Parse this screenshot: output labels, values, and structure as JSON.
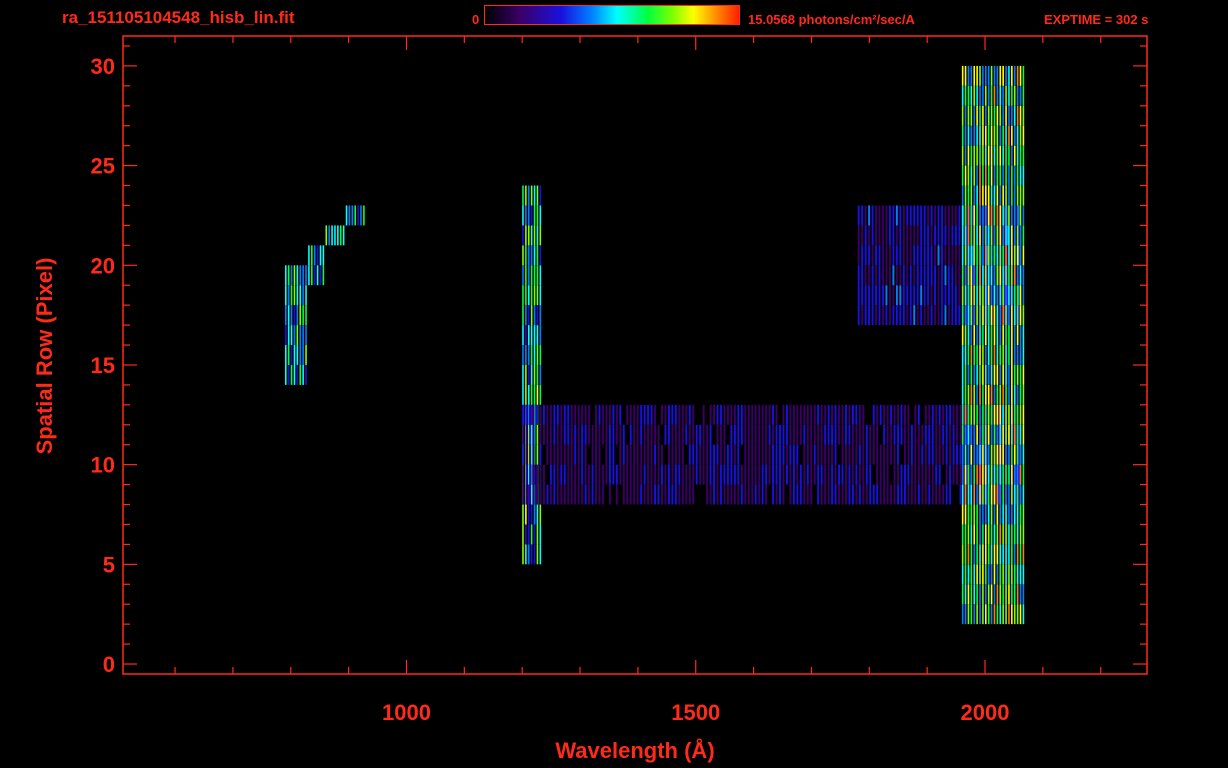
{
  "header": {
    "file_title": "ra_151105104548_hisb_lin.fit",
    "colorbar_min": "0",
    "colorbar_max_label": "15.0568 photons/cm²/sec/A",
    "exptime": "EXPTIME = 302 s"
  },
  "colors": {
    "axis": "#ff2a1a",
    "background": "#000000",
    "colormap": [
      "#000000",
      "#3a0068",
      "#1a10e0",
      "#0080ff",
      "#00ffff",
      "#00ff40",
      "#80ff00",
      "#ffff00",
      "#ff8000",
      "#ff2000"
    ]
  },
  "chart_data": {
    "type": "heatmap",
    "xlabel": "Wavelength (Å)",
    "ylabel": "Spatial Row (Pixel)",
    "xlim": [
      510,
      2280
    ],
    "ylim": [
      -0.5,
      31.5
    ],
    "x_ticks": [
      1000,
      1500,
      2000
    ],
    "y_ticks": [
      0,
      5,
      10,
      15,
      20,
      25,
      30
    ],
    "color_range": [
      0,
      15.0568
    ],
    "color_unit": "photons/cm²/sec/A",
    "features": [
      {
        "name": "arc",
        "x": [
          790,
          805,
          830,
          860,
          895,
          930
        ],
        "rows": [
          [
            14,
            20
          ],
          [
            14,
            20
          ],
          [
            19,
            21
          ],
          [
            21,
            22
          ],
          [
            22,
            23
          ],
          [
            19,
            22
          ]
        ],
        "intensity": 9
      },
      {
        "name": "line",
        "x": [
          1200,
          1235
        ],
        "rows": [
          [
            5,
            24
          ]
        ],
        "intensity": 10
      },
      {
        "name": "band",
        "x": [
          1200,
          2060
        ],
        "rows": [
          [
            8,
            13
          ]
        ],
        "intensity": 3
      },
      {
        "name": "band",
        "x": [
          1780,
          2060
        ],
        "rows": [
          [
            17,
            23
          ]
        ],
        "intensity": 4
      },
      {
        "name": "edge",
        "x": [
          1960,
          2070
        ],
        "rows": [
          [
            2,
            30
          ]
        ],
        "intensity": 12
      }
    ]
  }
}
